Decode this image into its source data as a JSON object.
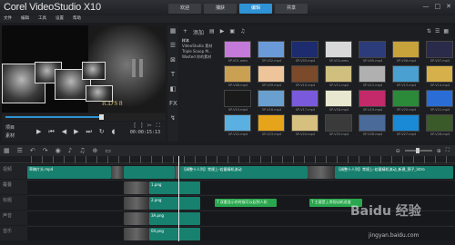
{
  "app": {
    "title": "Corel VideoStudio X10"
  },
  "tabs": [
    {
      "label": "捕获"
    },
    {
      "label": "编辑",
      "active": true
    },
    {
      "label": "共享"
    }
  ],
  "tabs_extra": [
    {
      "label": "欢迎"
    }
  ],
  "window_buttons": [
    "—",
    "□",
    "✕"
  ],
  "menu": [
    "文件",
    "编辑",
    "工具",
    "设置",
    "帮助"
  ],
  "preview": {
    "overlay_text": "ICD'S 8",
    "mode_labels": [
      "项目",
      "素材"
    ],
    "timecode": "00:00:15:13",
    "progress_fraction": 0.62
  },
  "library": {
    "toolbar": [
      "+",
      "添加"
    ],
    "folders": [
      {
        "label": "样本",
        "selected": true
      },
      {
        "label": "VideoStudio 素材"
      },
      {
        "label": "Triple Scoop M..."
      },
      {
        "label": "Wasted 你的素材"
      }
    ],
    "thumbs": [
      {
        "label": "SP-V01.wmv",
        "color": "#c47ad8"
      },
      {
        "label": "SP-V02.mp4",
        "color": "#6a9bd8"
      },
      {
        "label": "SP-V03.mp4",
        "color": "#1c2c6e"
      },
      {
        "label": "SP-V04.wmv",
        "color": "#d9d9d9"
      },
      {
        "label": "SP-V05.mp4",
        "color": "#2c3c7a"
      },
      {
        "label": "SP-V06.mp4",
        "color": "#c8a23a"
      },
      {
        "label": "SP-V07.mp4",
        "color": "#2a2a4a"
      },
      {
        "label": "SP-V08.mp4",
        "color": "#caa052"
      },
      {
        "label": "SP-V09.mp4",
        "color": "#eec49a"
      },
      {
        "label": "SP-V10.mp4",
        "color": "#7a4a2a"
      },
      {
        "label": "SP-V11.mp4",
        "color": "#d0c080"
      },
      {
        "label": "SP-V12.mp4",
        "color": "#b0b0b0"
      },
      {
        "label": "SP-V13.mp4",
        "color": "#4aa0d0"
      },
      {
        "label": "SP-V14.mp4",
        "color": "#d6b04a"
      },
      {
        "label": "SP-V15.mp4",
        "color": "#1a1a1a"
      },
      {
        "label": "SP-V16.mp4",
        "color": "#6aa0d0"
      },
      {
        "label": "SP-V17.mp4",
        "color": "#7a5adc"
      },
      {
        "label": "SP-V18.mp4",
        "color": "#e8e8d0"
      },
      {
        "label": "SP-V19.mp4",
        "color": "#c42a6a"
      },
      {
        "label": "SP-V20.mp4",
        "color": "#2a8a3a"
      },
      {
        "label": "SP-V21.mp4",
        "color": "#2b6dd6"
      },
      {
        "label": "SP-V22.mp4",
        "color": "#5ab0e0"
      },
      {
        "label": "SP-V23.mp4",
        "color": "#e6a41a"
      },
      {
        "label": "SP-V24.mp4",
        "color": "#d6c080"
      },
      {
        "label": "SP-V25.mp4",
        "color": "#3a3a3a"
      },
      {
        "label": "SP-V26.mp4",
        "color": "#4a6a9a"
      },
      {
        "label": "SP-V27.mp4",
        "color": "#1a8ad6"
      },
      {
        "label": "SP-V28.mp4",
        "color": "#3a5a2a"
      }
    ]
  },
  "timeline": {
    "tracks": [
      {
        "label": "视频",
        "clips": [
          {
            "label": "草稿片头.mp4",
            "style": "teal"
          },
          {
            "label": "",
            "style": "thumbish"
          },
          {
            "label": "",
            "style": "teal"
          },
          {
            "label": "",
            "style": "thumbish"
          },
          {
            "label": "【调整十人列】常规上-若量精机流动",
            "style": "teal"
          },
          {
            "label": "",
            "style": "thumbish"
          },
          {
            "label": "【调整十人列】常规上-若量精机流动_新建_预子_Intro",
            "style": "teal"
          }
        ]
      },
      {
        "label": "覆叠",
        "clips": [
          {
            "label": "",
            "style": "thumbish"
          },
          {
            "label": "1.png",
            "style": "teal"
          }
        ]
      },
      {
        "label": "标题",
        "clips": [
          {
            "label": "",
            "style": "thumbish"
          },
          {
            "label": "2.png",
            "style": "teal"
          },
          {
            "label": "T  双重显示的时候可以起到人机",
            "style": "title"
          },
          {
            "label": "T  主要是上常规动机进度",
            "style": "title"
          }
        ]
      },
      {
        "label": "声音",
        "clips": [
          {
            "label": "",
            "style": "thumbish"
          },
          {
            "label": "3A.png",
            "style": "teal"
          }
        ]
      },
      {
        "label": "音乐",
        "clips": [
          {
            "label": "",
            "style": "thumbish"
          },
          {
            "label": "04.png",
            "style": "teal"
          }
        ]
      }
    ]
  },
  "watermark": {
    "text": "Baidu 经验",
    "url": "jingyan.baidu.com"
  }
}
